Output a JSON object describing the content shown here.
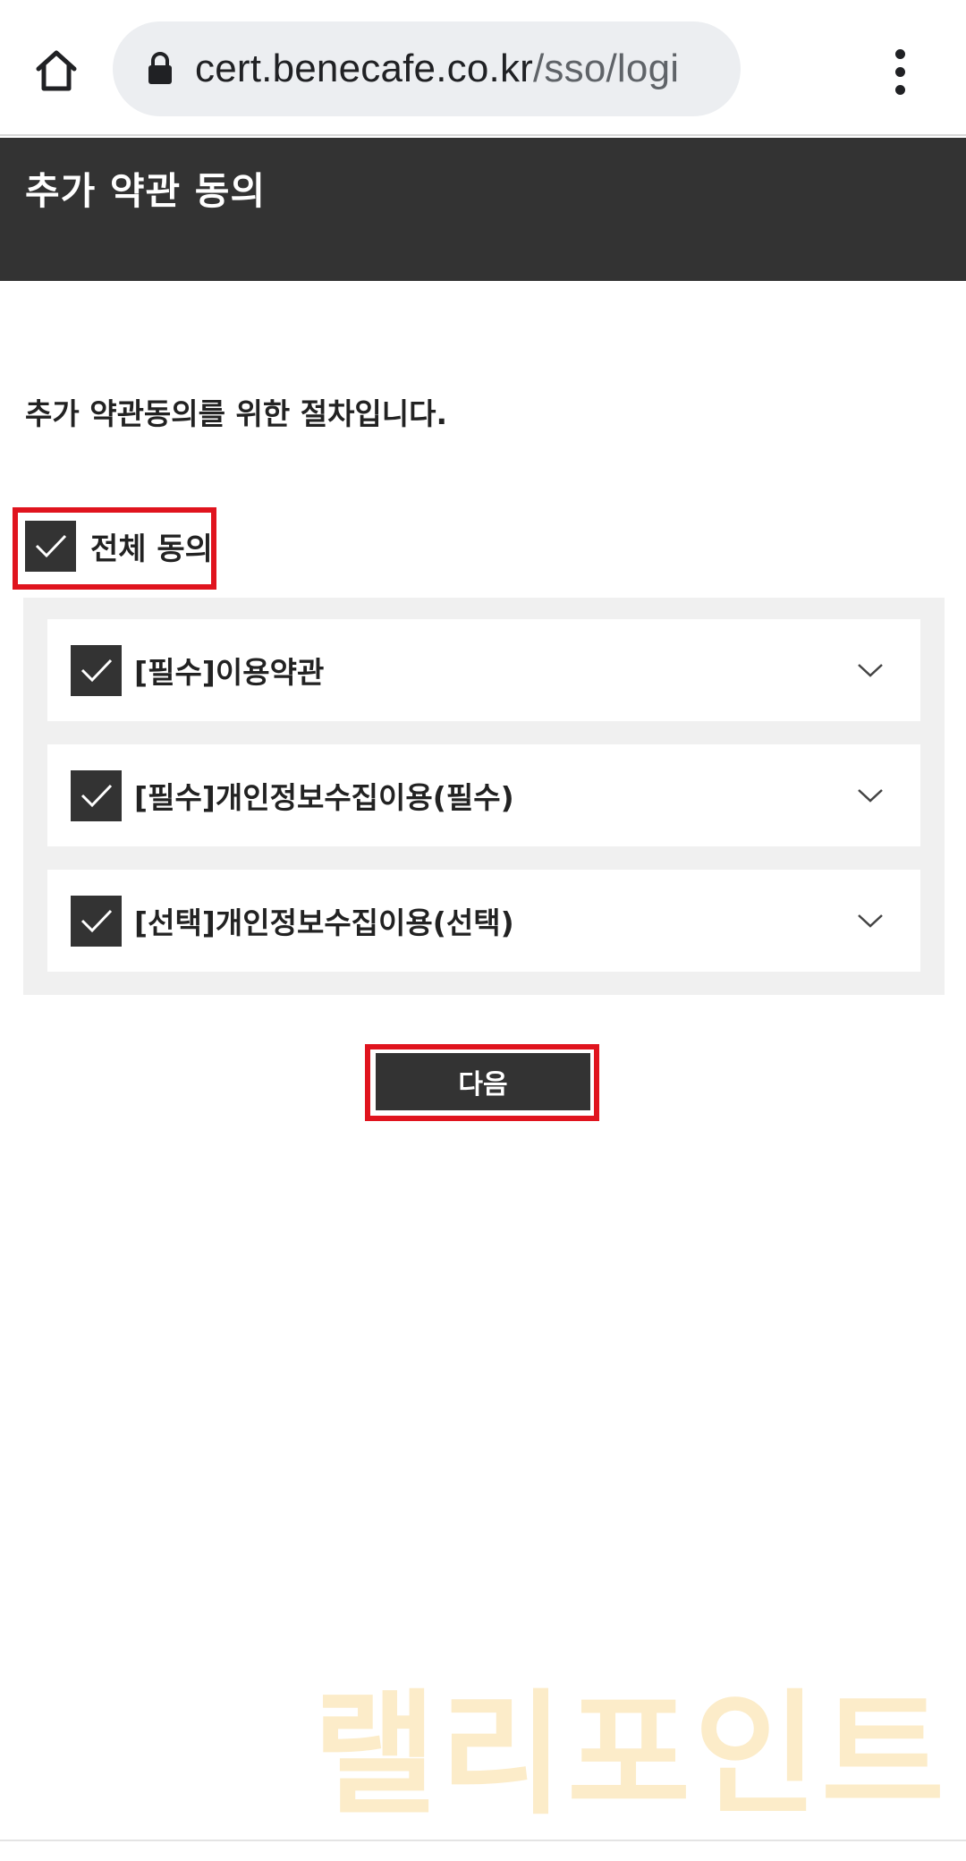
{
  "browser": {
    "url_host": "cert.benecafe.co.kr",
    "url_path": "/sso/logi",
    "home_icon": "home-icon",
    "lock_icon": "lock-icon",
    "menu_icon": "more-vert-icon"
  },
  "header": {
    "title": "추가 약관 동의"
  },
  "intro": "추가 약관동의를 위한 절차입니다.",
  "agree_all": {
    "label": "전체 동의",
    "checked": true
  },
  "terms": [
    {
      "label": "[필수]이용약관",
      "checked": true
    },
    {
      "label": "[필수]개인정보수집이용(필수)",
      "checked": true
    },
    {
      "label": "[선택]개인정보수집이용(선택)",
      "checked": true
    }
  ],
  "next_button": {
    "label": "다음"
  },
  "watermark": "랠리포인트",
  "colors": {
    "header_bg": "#333333",
    "checkbox_bg": "#333333",
    "highlight": "#e0141e",
    "panel_bg": "#f0f0f0",
    "watermark": "#fbe6b8"
  }
}
